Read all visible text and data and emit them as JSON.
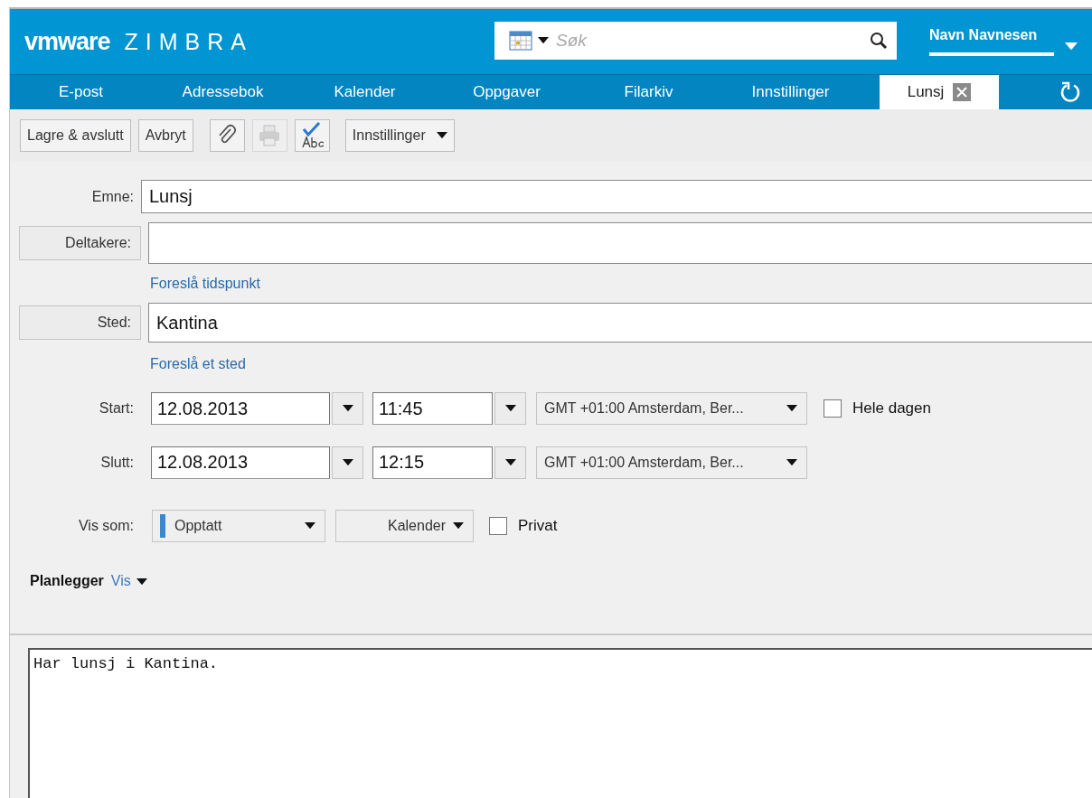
{
  "header": {
    "logo": {
      "brand": "vmware",
      "product": "ZIMBRA"
    },
    "search": {
      "placeholder": "Søk"
    },
    "user": "Navn Navnesen"
  },
  "nav_tabs": [
    {
      "label": "E-post",
      "selected": false,
      "kind": "app"
    },
    {
      "label": "Adressebok",
      "selected": false,
      "kind": "app"
    },
    {
      "label": "Kalender",
      "selected": false,
      "kind": "app"
    },
    {
      "label": "Oppgaver",
      "selected": false,
      "kind": "app"
    },
    {
      "label": "Filarkiv",
      "selected": false,
      "kind": "app"
    },
    {
      "label": "Innstillinger",
      "selected": false,
      "kind": "app"
    },
    {
      "label": "Lunsj",
      "selected": true,
      "kind": "document"
    }
  ],
  "toolbar": [
    {
      "kind": "button",
      "label": "Lagre & avslutt"
    },
    {
      "kind": "button",
      "label": "Avbryt"
    },
    {
      "kind": "attach",
      "disabled": false
    },
    {
      "kind": "print",
      "disabled": true
    },
    {
      "kind": "spellcheck",
      "disabled": false
    },
    {
      "kind": "menu",
      "label": "Innstillinger"
    }
  ],
  "form": {
    "subject": {
      "label": "Emne:",
      "value": "Lunsj"
    },
    "attendees": {
      "label": "Deltakere:"
    },
    "suggest_time_link": "Foreslå tidspunkt",
    "location": {
      "label": "Sted:",
      "value": "Kantina"
    },
    "suggest_location_link": "Foreslå et sted",
    "start": {
      "label": "Start:",
      "date": "12.08.2013",
      "time": "11:45",
      "timezone": "GMT +01:00 Amsterdam, Ber..."
    },
    "all_day": {
      "label": "Hele dagen",
      "checked": false
    },
    "end": {
      "label": "Slutt:",
      "date": "12.08.2013",
      "time": "12:15",
      "timezone": "GMT +01:00 Amsterdam, Ber..."
    },
    "show_as": {
      "label": "Vis som:",
      "value": "Opptatt"
    },
    "calendar": {
      "value": "Kalender"
    },
    "private": {
      "label": "Privat",
      "checked": false
    },
    "scheduler": {
      "label": "Planlegger",
      "link": "Vis"
    }
  },
  "notes": "Har lunsj i Kantina."
}
